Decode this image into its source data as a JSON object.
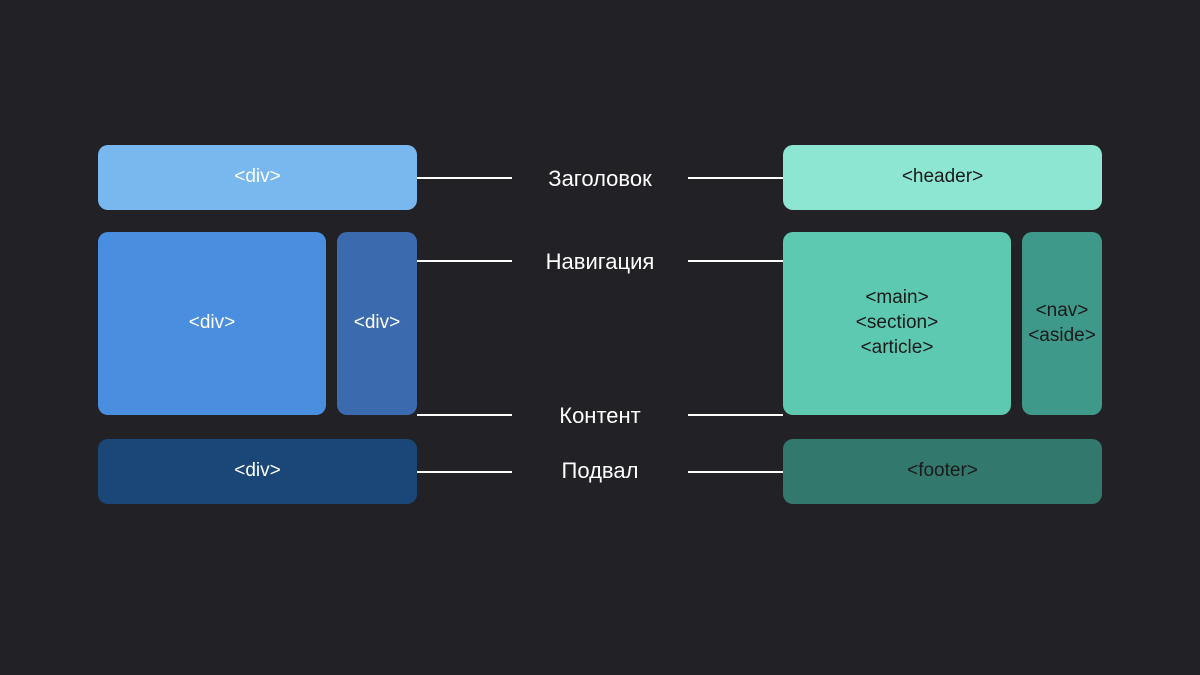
{
  "left": {
    "header": "<div>",
    "main": "<div>",
    "nav": "<div>",
    "footer": "<div>"
  },
  "right": {
    "header": "<header>",
    "main": "<main>\n<section>\n<article>",
    "nav": "<nav>\n<aside>",
    "footer": "<footer>"
  },
  "labels": {
    "header": "Заголовок",
    "nav": "Навигация",
    "content": "Контент",
    "footer": "Подвал"
  },
  "colors": {
    "bg": "#222226",
    "left_header": "#78b8ef",
    "left_main": "#4a8fdf",
    "left_nav": "#3b6aae",
    "left_footer": "#1a4778",
    "right_header": "#8de6d2",
    "right_main": "#5cc9b0",
    "right_nav": "#3f998a",
    "right_footer": "#33786d"
  }
}
